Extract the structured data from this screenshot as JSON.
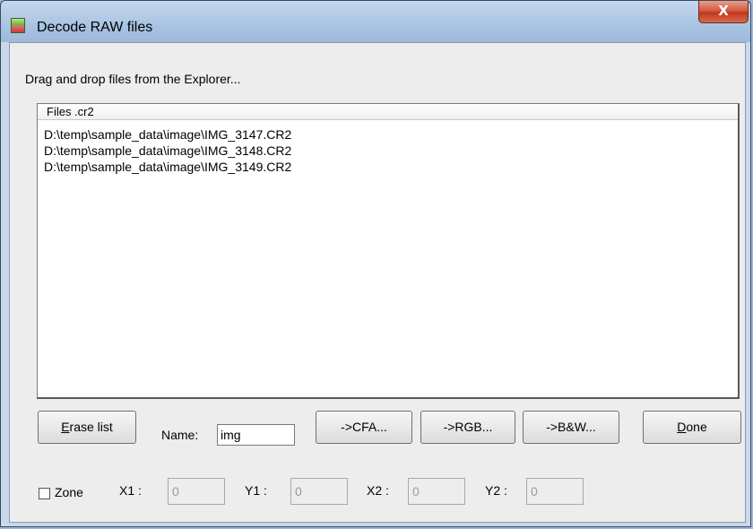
{
  "window": {
    "title": "Decode RAW files",
    "close_label": "X"
  },
  "hint": "Drag and drop files from the Explorer...",
  "list": {
    "header": "Files .cr2",
    "items": [
      "D:\\temp\\sample_data\\image\\IMG_3147.CR2",
      "D:\\temp\\sample_data\\image\\IMG_3148.CR2",
      "D:\\temp\\sample_data\\image\\IMG_3149.CR2"
    ]
  },
  "controls": {
    "erase_prefix": "E",
    "erase_rest": "rase list",
    "name_label": "Name:",
    "name_value": "img",
    "cfa": "->CFA...",
    "rgb": "->RGB...",
    "bw": "->B&W...",
    "done_prefix": "D",
    "done_rest": "one"
  },
  "zone": {
    "checkbox_label": "Zone",
    "checked": false,
    "x1_label": "X1 :",
    "x1_value": "0",
    "y1_label": "Y1 :",
    "y1_value": "0",
    "x2_label": "X2 :",
    "x2_value": "0",
    "y2_label": "Y2 :",
    "y2_value": "0"
  }
}
